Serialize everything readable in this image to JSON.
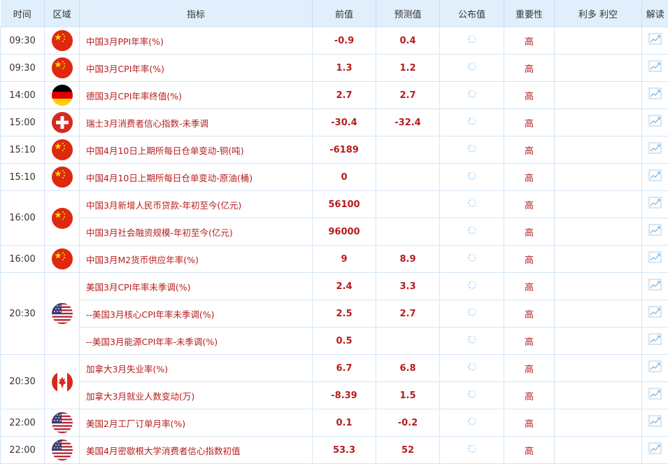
{
  "header": {
    "time": "时间",
    "region": "区域",
    "indicator": "指标",
    "previous": "前值",
    "forecast": "预测值",
    "actual": "公布值",
    "importance": "重要性",
    "effect": "利多 利空",
    "interpret": "解读"
  },
  "rows": [
    {
      "time": "09:30",
      "flag": "china",
      "indicator": "中国3月PPI年率(%)",
      "previous": "-0.9",
      "forecast": "0.4",
      "importance": "高"
    },
    {
      "time": "09:30",
      "flag": "china",
      "indicator": "中国3月CPI年率(%)",
      "previous": "1.3",
      "forecast": "1.2",
      "importance": "高"
    },
    {
      "time": "14:00",
      "flag": "germany",
      "indicator": "德国3月CPI年率终值(%)",
      "previous": "2.7",
      "forecast": "2.7",
      "importance": "高"
    },
    {
      "time": "15:00",
      "flag": "switzerland",
      "indicator": "瑞士3月消费者信心指数-未季调",
      "previous": "-30.4",
      "forecast": "-32.4",
      "importance": "高"
    },
    {
      "time": "15:10",
      "flag": "china",
      "indicator": "中国4月10日上期所每日仓单变动-铜(吨)",
      "previous": "-6189",
      "forecast": "",
      "importance": "高"
    },
    {
      "time": "15:10",
      "flag": "china",
      "indicator": "中国4月10日上期所每日仓单变动-原油(桶)",
      "previous": "0",
      "forecast": "",
      "importance": "高"
    },
    {
      "time": "16:00",
      "flag": "china",
      "indicator": "中国3月新增人民币贷款-年初至今(亿元)",
      "previous": "56100",
      "forecast": "",
      "importance": "高"
    },
    {
      "time": "",
      "flag": "",
      "indicator": "中国3月社会融资规模-年初至今(亿元)",
      "previous": "96000",
      "forecast": "",
      "importance": "高"
    },
    {
      "time": "16:00",
      "flag": "china",
      "indicator": "中国3月M2货币供应年率(%)",
      "previous": "9",
      "forecast": "8.9",
      "importance": "高"
    },
    {
      "time": "20:30",
      "flag": "usa",
      "indicator": "美国3月CPI年率未季调(%)",
      "previous": "2.4",
      "forecast": "3.3",
      "importance": "高"
    },
    {
      "time": "",
      "flag": "",
      "indicator": "--美国3月核心CPI年率未季调(%)",
      "previous": "2.5",
      "forecast": "2.7",
      "importance": "高"
    },
    {
      "time": "",
      "flag": "",
      "indicator": "--美国3月能源CPI年率-未季调(%)",
      "previous": "0.5",
      "forecast": "",
      "importance": "高"
    },
    {
      "time": "20:30",
      "flag": "canada",
      "indicator": "加拿大3月失业率(%)",
      "previous": "6.7",
      "forecast": "6.8",
      "importance": "高"
    },
    {
      "time": "",
      "flag": "",
      "indicator": "加拿大3月就业人数变动(万)",
      "previous": "-8.39",
      "forecast": "1.5",
      "importance": "高"
    },
    {
      "time": "22:00",
      "flag": "usa",
      "indicator": "美国2月工厂订单月率(%)",
      "previous": "0.1",
      "forecast": "-0.2",
      "importance": "高"
    },
    {
      "time": "22:00",
      "flag": "usa",
      "indicator": "美国4月密歇根大学消费者信心指数初值",
      "previous": "53.3",
      "forecast": "52",
      "importance": "高"
    }
  ],
  "colors": {
    "header_bg": "#e0effb",
    "accent_red": "#b71c1c",
    "border": "#d4e6f6"
  }
}
